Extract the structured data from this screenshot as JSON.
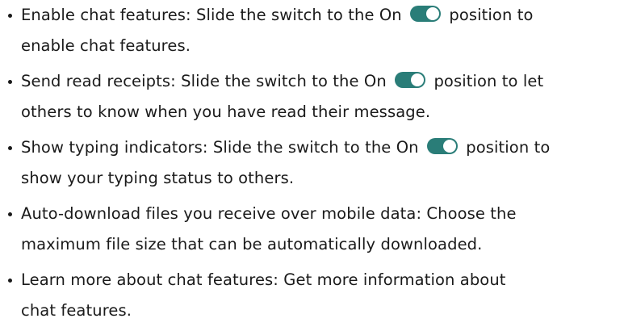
{
  "items": [
    {
      "line1_before": "Enable chat features: Slide the switch to the On",
      "line1_after": "position to",
      "line2": "enable chat features."
    },
    {
      "line1_before": "Send read receipts: Slide the switch to the On",
      "line1_after": "position to let",
      "line2": "others to know when you have read their message."
    },
    {
      "line1_before": "Show typing indicators: Slide the switch to the On",
      "line1_after": "position to",
      "line2": "show your typing status to others."
    },
    {
      "line1": "Auto-download files you receive over mobile data: Choose the",
      "line2": "maximum file size that can be automatically downloaded."
    },
    {
      "line1": "Learn more about chat features: Get more information about",
      "line2": "chat features."
    }
  ],
  "toggle": {
    "state": "on",
    "track_color": "#2a7d78",
    "knob_color": "#ffffff"
  }
}
